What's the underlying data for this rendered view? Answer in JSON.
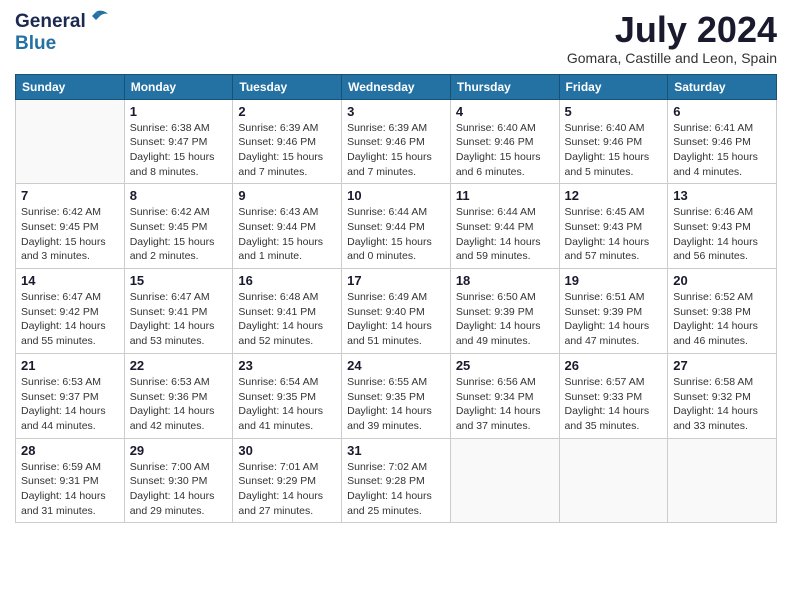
{
  "header": {
    "logo_general": "General",
    "logo_blue": "Blue",
    "month_title": "July 2024",
    "location": "Gomara, Castille and Leon, Spain"
  },
  "calendar": {
    "days_of_week": [
      "Sunday",
      "Monday",
      "Tuesday",
      "Wednesday",
      "Thursday",
      "Friday",
      "Saturday"
    ],
    "weeks": [
      [
        {
          "day": "",
          "info": ""
        },
        {
          "day": "1",
          "info": "Sunrise: 6:38 AM\nSunset: 9:47 PM\nDaylight: 15 hours\nand 8 minutes."
        },
        {
          "day": "2",
          "info": "Sunrise: 6:39 AM\nSunset: 9:46 PM\nDaylight: 15 hours\nand 7 minutes."
        },
        {
          "day": "3",
          "info": "Sunrise: 6:39 AM\nSunset: 9:46 PM\nDaylight: 15 hours\nand 7 minutes."
        },
        {
          "day": "4",
          "info": "Sunrise: 6:40 AM\nSunset: 9:46 PM\nDaylight: 15 hours\nand 6 minutes."
        },
        {
          "day": "5",
          "info": "Sunrise: 6:40 AM\nSunset: 9:46 PM\nDaylight: 15 hours\nand 5 minutes."
        },
        {
          "day": "6",
          "info": "Sunrise: 6:41 AM\nSunset: 9:46 PM\nDaylight: 15 hours\nand 4 minutes."
        }
      ],
      [
        {
          "day": "7",
          "info": "Sunrise: 6:42 AM\nSunset: 9:45 PM\nDaylight: 15 hours\nand 3 minutes."
        },
        {
          "day": "8",
          "info": "Sunrise: 6:42 AM\nSunset: 9:45 PM\nDaylight: 15 hours\nand 2 minutes."
        },
        {
          "day": "9",
          "info": "Sunrise: 6:43 AM\nSunset: 9:44 PM\nDaylight: 15 hours\nand 1 minute."
        },
        {
          "day": "10",
          "info": "Sunrise: 6:44 AM\nSunset: 9:44 PM\nDaylight: 15 hours\nand 0 minutes."
        },
        {
          "day": "11",
          "info": "Sunrise: 6:44 AM\nSunset: 9:44 PM\nDaylight: 14 hours\nand 59 minutes."
        },
        {
          "day": "12",
          "info": "Sunrise: 6:45 AM\nSunset: 9:43 PM\nDaylight: 14 hours\nand 57 minutes."
        },
        {
          "day": "13",
          "info": "Sunrise: 6:46 AM\nSunset: 9:43 PM\nDaylight: 14 hours\nand 56 minutes."
        }
      ],
      [
        {
          "day": "14",
          "info": "Sunrise: 6:47 AM\nSunset: 9:42 PM\nDaylight: 14 hours\nand 55 minutes."
        },
        {
          "day": "15",
          "info": "Sunrise: 6:47 AM\nSunset: 9:41 PM\nDaylight: 14 hours\nand 53 minutes."
        },
        {
          "day": "16",
          "info": "Sunrise: 6:48 AM\nSunset: 9:41 PM\nDaylight: 14 hours\nand 52 minutes."
        },
        {
          "day": "17",
          "info": "Sunrise: 6:49 AM\nSunset: 9:40 PM\nDaylight: 14 hours\nand 51 minutes."
        },
        {
          "day": "18",
          "info": "Sunrise: 6:50 AM\nSunset: 9:39 PM\nDaylight: 14 hours\nand 49 minutes."
        },
        {
          "day": "19",
          "info": "Sunrise: 6:51 AM\nSunset: 9:39 PM\nDaylight: 14 hours\nand 47 minutes."
        },
        {
          "day": "20",
          "info": "Sunrise: 6:52 AM\nSunset: 9:38 PM\nDaylight: 14 hours\nand 46 minutes."
        }
      ],
      [
        {
          "day": "21",
          "info": "Sunrise: 6:53 AM\nSunset: 9:37 PM\nDaylight: 14 hours\nand 44 minutes."
        },
        {
          "day": "22",
          "info": "Sunrise: 6:53 AM\nSunset: 9:36 PM\nDaylight: 14 hours\nand 42 minutes."
        },
        {
          "day": "23",
          "info": "Sunrise: 6:54 AM\nSunset: 9:35 PM\nDaylight: 14 hours\nand 41 minutes."
        },
        {
          "day": "24",
          "info": "Sunrise: 6:55 AM\nSunset: 9:35 PM\nDaylight: 14 hours\nand 39 minutes."
        },
        {
          "day": "25",
          "info": "Sunrise: 6:56 AM\nSunset: 9:34 PM\nDaylight: 14 hours\nand 37 minutes."
        },
        {
          "day": "26",
          "info": "Sunrise: 6:57 AM\nSunset: 9:33 PM\nDaylight: 14 hours\nand 35 minutes."
        },
        {
          "day": "27",
          "info": "Sunrise: 6:58 AM\nSunset: 9:32 PM\nDaylight: 14 hours\nand 33 minutes."
        }
      ],
      [
        {
          "day": "28",
          "info": "Sunrise: 6:59 AM\nSunset: 9:31 PM\nDaylight: 14 hours\nand 31 minutes."
        },
        {
          "day": "29",
          "info": "Sunrise: 7:00 AM\nSunset: 9:30 PM\nDaylight: 14 hours\nand 29 minutes."
        },
        {
          "day": "30",
          "info": "Sunrise: 7:01 AM\nSunset: 9:29 PM\nDaylight: 14 hours\nand 27 minutes."
        },
        {
          "day": "31",
          "info": "Sunrise: 7:02 AM\nSunset: 9:28 PM\nDaylight: 14 hours\nand 25 minutes."
        },
        {
          "day": "",
          "info": ""
        },
        {
          "day": "",
          "info": ""
        },
        {
          "day": "",
          "info": ""
        }
      ]
    ]
  }
}
